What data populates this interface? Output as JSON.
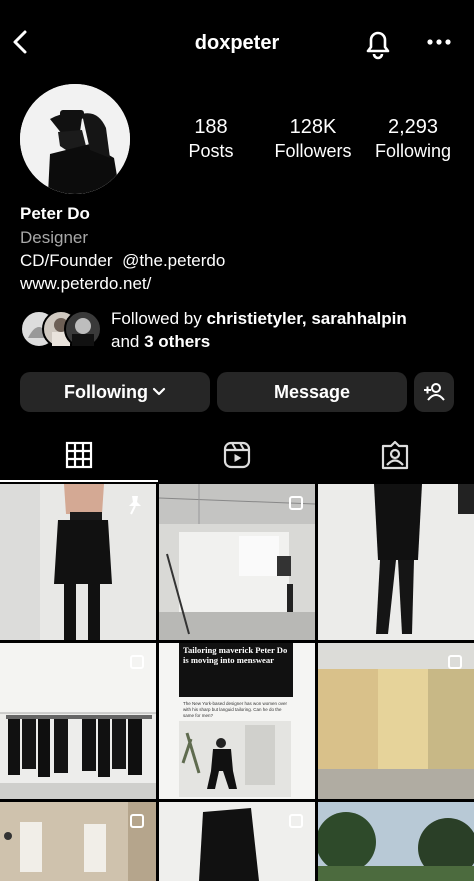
{
  "header": {
    "username": "doxpeter"
  },
  "stats": [
    {
      "value": "188",
      "label": "Posts"
    },
    {
      "value": "128K",
      "label": "Followers"
    },
    {
      "value": "2,293",
      "label": "Following"
    }
  ],
  "profile": {
    "name": "Peter Do",
    "category": "Designer",
    "bio_prefix": "CD/Founder",
    "bio_mention": "@the.peterdo",
    "website": "www.peterdo.net/"
  },
  "followed_by": {
    "prefix": "Followed by ",
    "users": "christietyler, sarahhalpin",
    "and_text": "and ",
    "others": "3 others"
  },
  "buttons": {
    "following": "Following",
    "message": "Message"
  },
  "post_text": {
    "headline": "Tailoring maverick Peter Do is moving into menswear",
    "subhead": "The New York-based designer has won women over with his sharp but languid tailoring. Can he do the same for men?"
  },
  "icons": {
    "back": "chevron-left-icon",
    "bell": "bell-icon",
    "more": "more-horizontal-icon",
    "chevron": "chevron-down-icon",
    "add_user": "add-user-icon",
    "grid": "grid-icon",
    "reels": "reels-icon",
    "tagged": "tagged-icon",
    "pin": "pin-icon",
    "multi": "multi-image-icon"
  }
}
